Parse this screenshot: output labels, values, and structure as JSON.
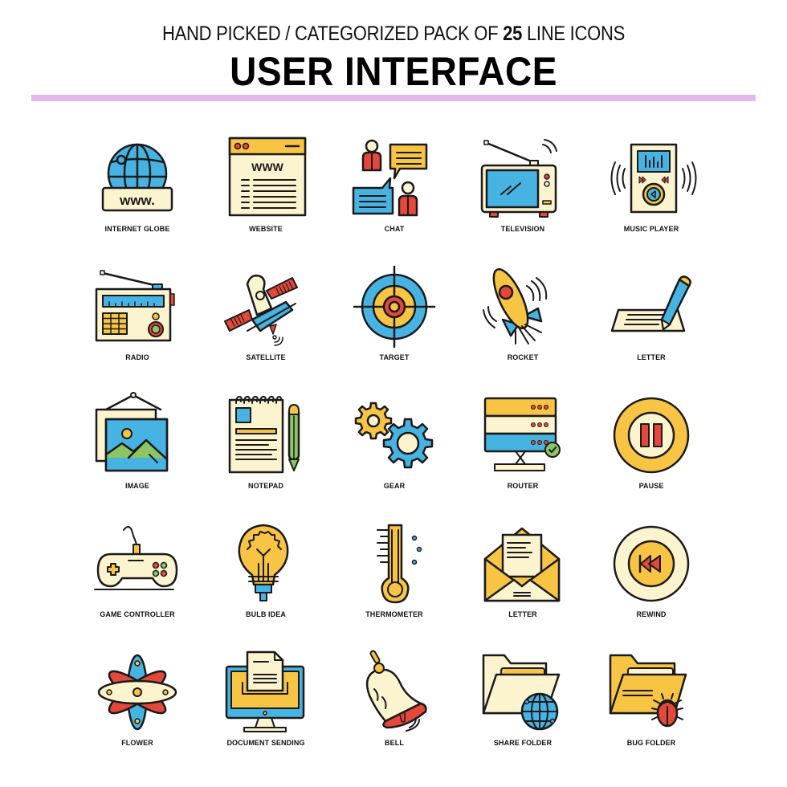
{
  "header": {
    "subtitle_prefix": "HAND PICKED / CATEGORIZED PACK OF ",
    "subtitle_count": "25",
    "subtitle_suffix": " LINE ICONS",
    "title": "USER INTERFACE"
  },
  "colors": {
    "divider": "#e4b8ec",
    "outline": "#1a1a1a",
    "blue": "#47b3e3",
    "yellow": "#f7c443",
    "cream": "#fcf3cf",
    "red": "#e4473b",
    "green": "#8cc563"
  },
  "icons": [
    {
      "label": "INTERNET GLOBE",
      "icon": "internet-globe-icon",
      "text": "www."
    },
    {
      "label": "WEBSITE",
      "icon": "website-icon",
      "text": "WWW"
    },
    {
      "label": "CHAT",
      "icon": "chat-icon"
    },
    {
      "label": "TELEVISION",
      "icon": "television-icon"
    },
    {
      "label": "MUSIC PLAYER",
      "icon": "music-player-icon"
    },
    {
      "label": "RADIO",
      "icon": "radio-icon"
    },
    {
      "label": "SATELLITE",
      "icon": "satellite-icon"
    },
    {
      "label": "TARGET",
      "icon": "target-icon"
    },
    {
      "label": "ROCKET",
      "icon": "rocket-icon"
    },
    {
      "label": "LETTER",
      "icon": "letter-pen-icon"
    },
    {
      "label": "IMAGE",
      "icon": "image-icon"
    },
    {
      "label": "NOTEPAD",
      "icon": "notepad-icon"
    },
    {
      "label": "GEAR",
      "icon": "gear-icon"
    },
    {
      "label": "ROUTER",
      "icon": "router-icon"
    },
    {
      "label": "PAUSE",
      "icon": "pause-icon"
    },
    {
      "label": "GAME CONTROLLER",
      "icon": "game-controller-icon"
    },
    {
      "label": "BULB IDEA",
      "icon": "bulb-idea-icon"
    },
    {
      "label": "THERMOMETER",
      "icon": "thermometer-icon"
    },
    {
      "label": "LETTER",
      "icon": "envelope-letter-icon"
    },
    {
      "label": "REWIND",
      "icon": "rewind-icon"
    },
    {
      "label": "FLOWER",
      "icon": "flower-icon"
    },
    {
      "label": "DOCUMENT SENDING",
      "icon": "document-sending-icon"
    },
    {
      "label": "BELL",
      "icon": "bell-icon"
    },
    {
      "label": "SHARE FOLDER",
      "icon": "share-folder-icon"
    },
    {
      "label": "BUG FOLDER",
      "icon": "bug-folder-icon"
    }
  ]
}
